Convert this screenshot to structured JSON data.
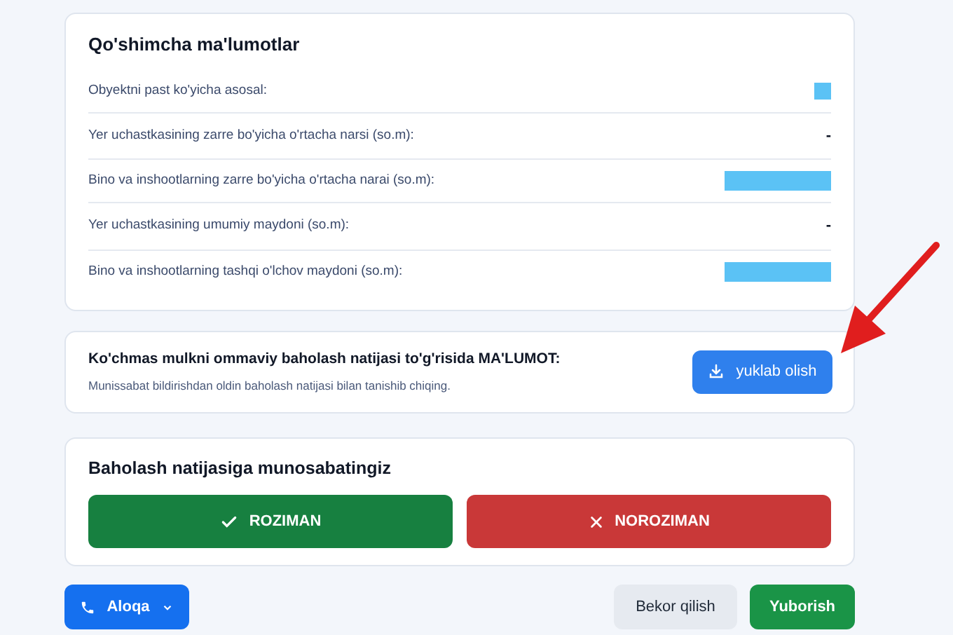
{
  "info_card": {
    "title": "Qo'shimcha ma'lumotlar",
    "rows": [
      {
        "label": "Obyektni past ko'yicha asosal:",
        "kind": "swatch"
      },
      {
        "label": "Yer uchastkasining zarre bo'yicha o'rtacha narsi (so.m):",
        "kind": "text",
        "value": "-"
      },
      {
        "label": "Bino va inshootlarning zarre bo'yicha o'rtacha narai (so.m):",
        "kind": "bar"
      },
      {
        "label": "Yer uchastkasining umumiy maydoni (so.m):",
        "kind": "text",
        "value": "-"
      },
      {
        "label": "Bino va inshootlarning tashqi o'lchov maydoni (so.m):",
        "kind": "bar"
      }
    ]
  },
  "download_card": {
    "title": "Ko'chmas mulkni ommaviy baholash natijasi to'g'risida MA'LUMOT:",
    "subtitle": "Munissabat bildirishdan oldin baholash natijasi bilan tanishib chiqing.",
    "button": "yuklab olish"
  },
  "opinion_card": {
    "title": "Baholash natijasiga munosabatingiz",
    "options": [
      {
        "label": "ROZIMAN",
        "kind": "agree"
      },
      {
        "label": "NOROZIMAN",
        "kind": "disagree"
      }
    ]
  },
  "footer": {
    "contact_button": "Aloqa",
    "cancel_button": "Bekor qilish",
    "submit_button": "Yuborish"
  }
}
